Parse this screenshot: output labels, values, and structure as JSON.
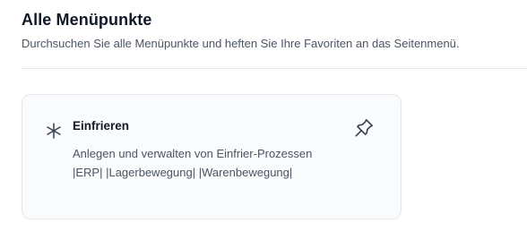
{
  "header": {
    "title": "Alle Menüpunkte",
    "subtitle": "Durchsuchen Sie alle Menüpunkte und heften Sie Ihre Favoriten an das Seitenmenü."
  },
  "items": [
    {
      "title": "Einfrieren",
      "description": "Anlegen und verwalten von Einfrier-Prozessen |ERP| |Lagerbewegung| |Warenbewegung|",
      "icon": "snowflake-icon",
      "action_icon": "pin-icon"
    }
  ],
  "colors": {
    "title": "#111827",
    "text": "#4b5563",
    "border": "#e5e7eb",
    "card_background": "#fafbfc"
  }
}
